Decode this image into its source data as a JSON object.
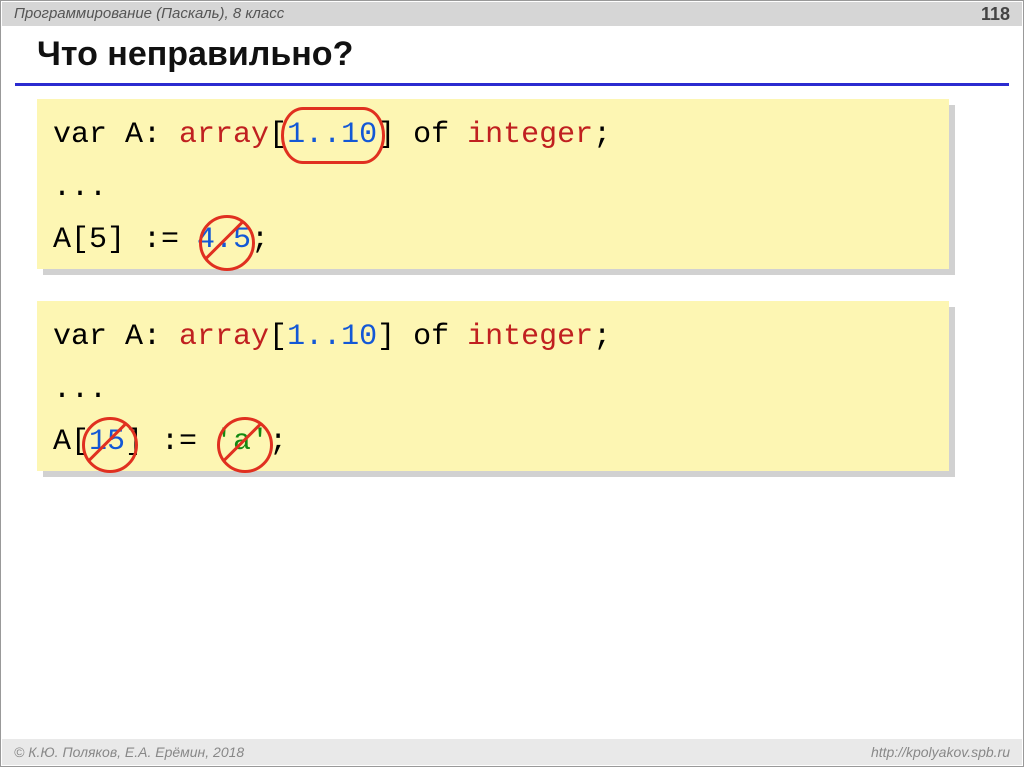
{
  "header": {
    "subject": "Программирование (Паскаль), 8 класс",
    "page": "118"
  },
  "title": "Что неправильно?",
  "code1": {
    "var": "var",
    "A": " A: ",
    "array": "array",
    "lbrack": "[",
    "range": "1..10",
    "rbrack": "]",
    "of": " of ",
    "type": "integer",
    "semi": ";",
    "dots": "...",
    "assign_left": "A[5] := ",
    "bad_value": "4.5",
    "assign_semi": ";"
  },
  "code2": {
    "var": "var",
    "A": " A: ",
    "array": "array",
    "lbrack": "[",
    "range": "1..10",
    "rbrack": "]",
    "of": " of ",
    "type": "integer",
    "semi": ";",
    "dots": "...",
    "assign_A": "A[",
    "bad_index": "15",
    "assign_mid": "] := ",
    "bad_char": "'a'",
    "assign_semi": ";"
  },
  "footer": {
    "copyright": "© К.Ю. Поляков, Е.А. Ерёмин, 2018",
    "url": "http://kpolyakov.spb.ru"
  }
}
